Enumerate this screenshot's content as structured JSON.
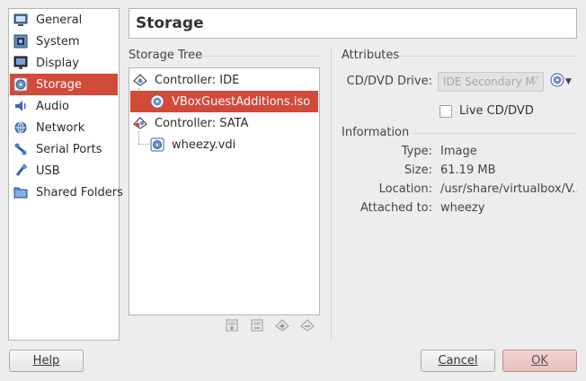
{
  "sidebar": {
    "items": [
      {
        "label": "General",
        "icon": "monitor-icon"
      },
      {
        "label": "System",
        "icon": "motherboard-icon"
      },
      {
        "label": "Display",
        "icon": "display-icon"
      },
      {
        "label": "Storage",
        "icon": "storage-icon",
        "active": true
      },
      {
        "label": "Audio",
        "icon": "speaker-icon"
      },
      {
        "label": "Network",
        "icon": "network-icon"
      },
      {
        "label": "Serial Ports",
        "icon": "serial-port-icon"
      },
      {
        "label": "USB",
        "icon": "usb-icon"
      },
      {
        "label": "Shared Folders",
        "icon": "folder-icon"
      }
    ]
  },
  "page": {
    "title": "Storage"
  },
  "storage_tree": {
    "heading": "Storage Tree",
    "rows": [
      {
        "label": "Controller: IDE",
        "kind": "controller",
        "icon": "ide-controller-icon"
      },
      {
        "label": "VBoxGuestAdditions.iso",
        "kind": "attachment",
        "icon": "optical-disc-icon",
        "selected": true
      },
      {
        "label": "Controller: SATA",
        "kind": "controller",
        "icon": "sata-controller-icon"
      },
      {
        "label": "wheezy.vdi",
        "kind": "attachment",
        "icon": "hard-disk-icon"
      }
    ],
    "toolbar": [
      "add-controller-icon",
      "remove-controller-icon",
      "add-attachment-icon",
      "remove-attachment-icon"
    ]
  },
  "attributes": {
    "heading": "Attributes",
    "drive_label": "CD/DVD Drive:",
    "drive_value": "IDE Secondary M",
    "live_label": "Live CD/DVD",
    "live_checked": false
  },
  "information": {
    "heading": "Information",
    "rows": [
      {
        "label": "Type:",
        "value": "Image"
      },
      {
        "label": "Size:",
        "value": "61.19 MB"
      },
      {
        "label": "Location:",
        "value": "/usr/share/virtualbox/V..."
      },
      {
        "label": "Attached to:",
        "value": "wheezy"
      }
    ]
  },
  "buttons": {
    "help": "Help",
    "cancel": "Cancel",
    "ok": "OK"
  },
  "colors": {
    "accent": "#d14a3a",
    "ok_bg": "#ecc9c5"
  }
}
